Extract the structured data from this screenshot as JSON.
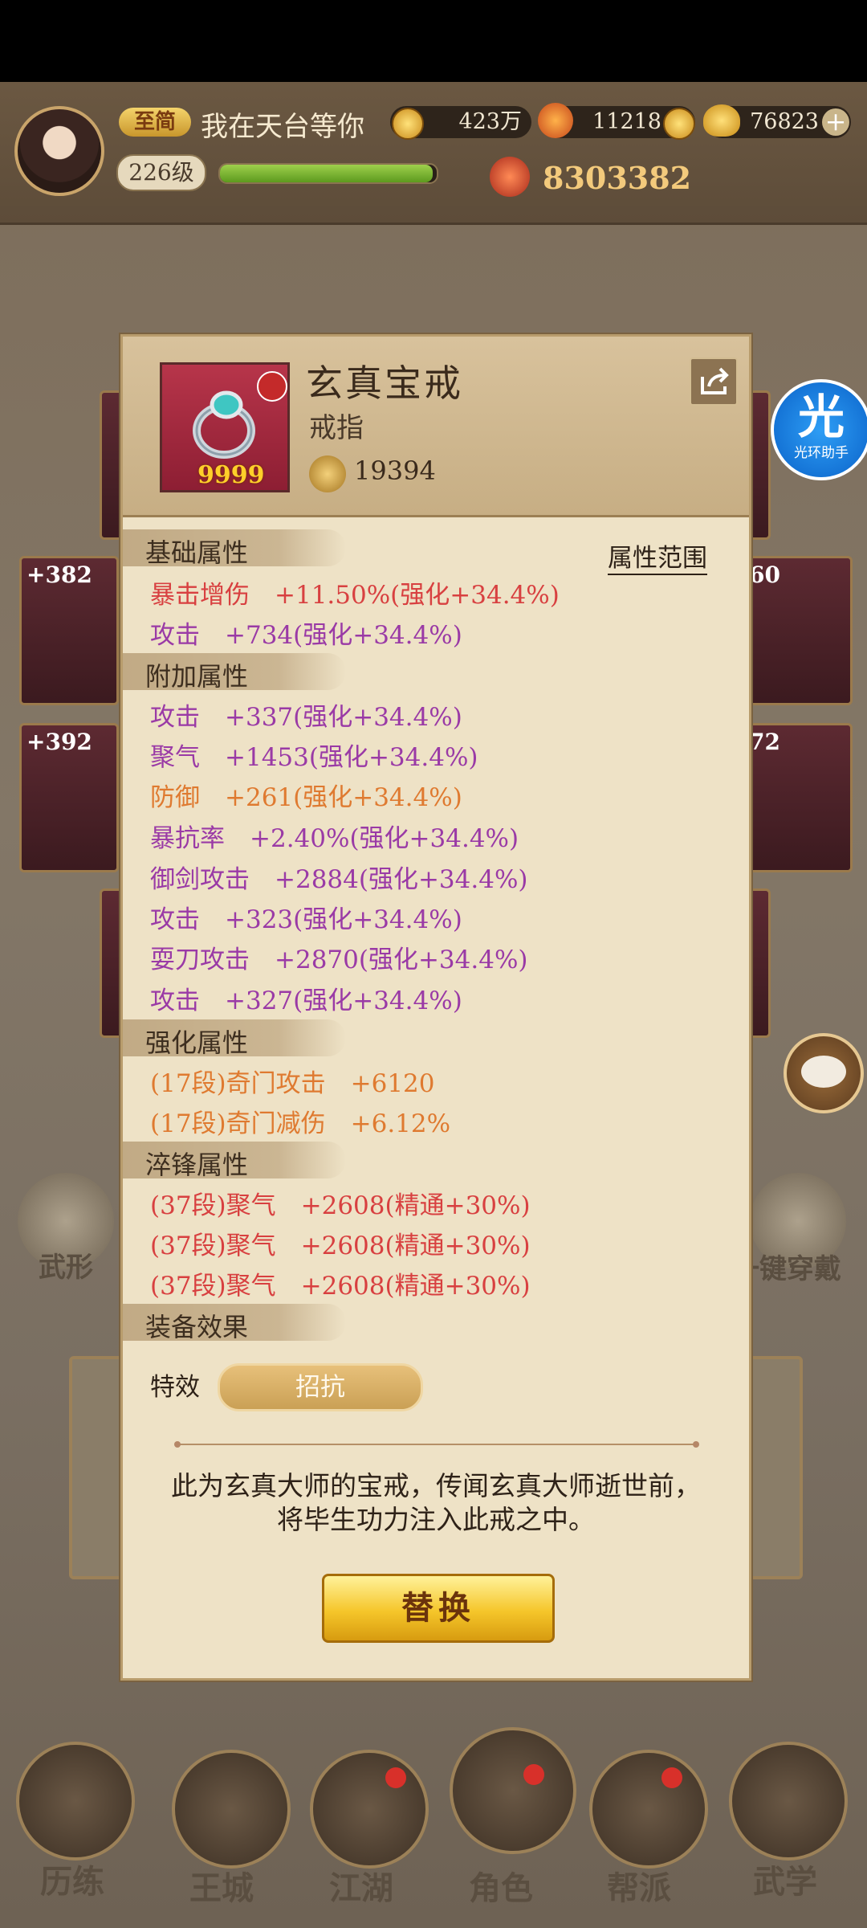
{
  "topbar": {
    "vip": "至简",
    "player_name": "我在天台等你",
    "coins": "423万",
    "currency2": "11218",
    "gold": "76823",
    "level": "226级",
    "power": "8303382"
  },
  "background": {
    "slots": [
      "+382",
      "+392",
      "60",
      "72"
    ],
    "side_left": "武形",
    "side_right": "一键穿戴"
  },
  "nav": [
    "历练",
    "王城",
    "江湖",
    "角色",
    "帮派",
    "武学"
  ],
  "floating": {
    "assist": "光环助手"
  },
  "item": {
    "name": "玄真宝戒",
    "type": "戒指",
    "quantity": "9999",
    "score": "19394",
    "range_label": "属性范围"
  },
  "sections": {
    "base": "基础属性",
    "extra": "附加属性",
    "enhance": "强化属性",
    "temper": "淬锋属性",
    "effect": "装备效果"
  },
  "base_attrs": [
    {
      "text": "暴击增伤　+11.50%(强化+34.4%)"
    },
    {
      "text": "攻击　+734(强化+34.4%)"
    }
  ],
  "extra_attrs": [
    {
      "text": "攻击　+337(强化+34.4%)"
    },
    {
      "text": "聚气　+1453(强化+34.4%)"
    },
    {
      "text": "防御　+261(强化+34.4%)"
    },
    {
      "text": "暴抗率　+2.40%(强化+34.4%)"
    },
    {
      "text": "御剑攻击　+2884(强化+34.4%)"
    },
    {
      "text": "攻击　+323(强化+34.4%)"
    },
    {
      "text": "耍刀攻击　+2870(强化+34.4%)"
    },
    {
      "text": "攻击　+327(强化+34.4%)"
    }
  ],
  "enhance_attrs": [
    {
      "text": "(17段)奇门攻击　+6120"
    },
    {
      "text": "(17段)奇门减伤　+6.12%"
    }
  ],
  "temper_attrs": [
    {
      "text": "(37段)聚气　+2608(精通+30%)"
    },
    {
      "text": "(37段)聚气　+2608(精通+30%)"
    },
    {
      "text": "(37段)聚气　+2608(精通+30%)"
    }
  ],
  "effect": {
    "label": "特效",
    "value": "招抗"
  },
  "description": "此为玄真大师的宝戒，传闻玄真大师逝世前，将毕生功力注入此戒之中。",
  "replace_button": "替换",
  "colors": {
    "red": "#d84040",
    "purple": "#9a3aa6",
    "orange": "#df7a30"
  }
}
